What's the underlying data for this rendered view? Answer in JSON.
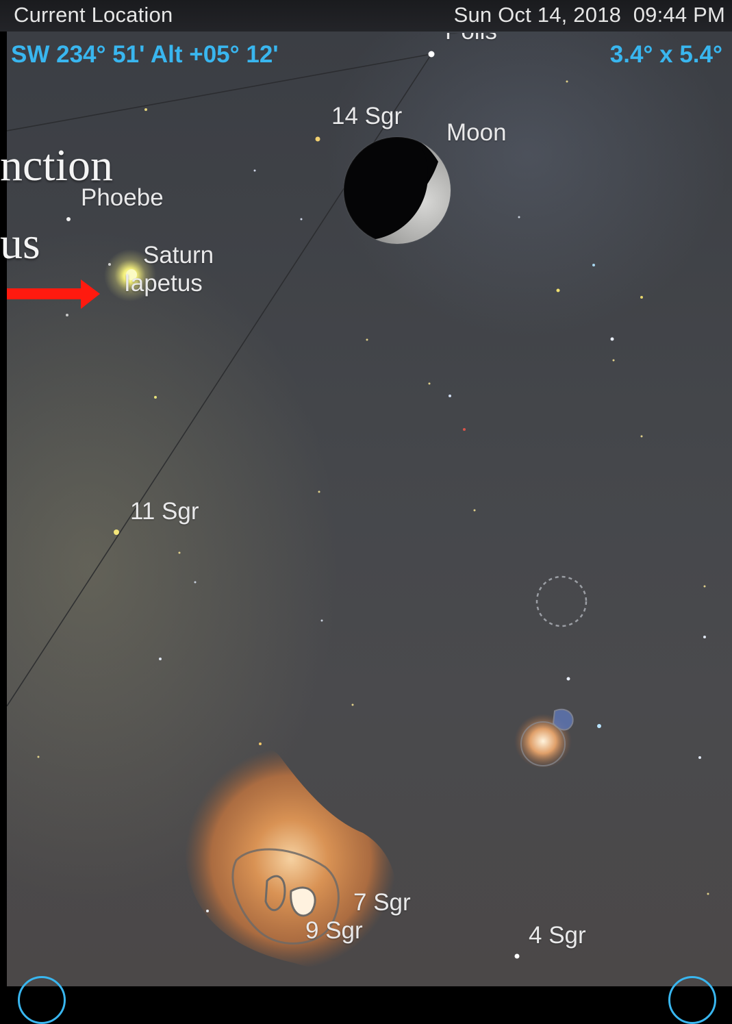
{
  "topbar": {
    "location": "Current Location",
    "datetime": "Sun Oct 14, 2018  09:44 PM"
  },
  "hud": {
    "pointing": "SW 234° 51' Alt +05° 12'",
    "field_of_view": "3.4° x 5.4°"
  },
  "slide_overlay": {
    "line1": "nction",
    "line2": "us"
  },
  "labels": {
    "polis": "Polis",
    "sgr14": "14 Sgr",
    "moon": "Moon",
    "phoebe": "Phoebe",
    "saturn": "Saturn",
    "iapetus": "Iapetus",
    "sgr11": "11 Sgr",
    "sgr7": "7 Sgr",
    "sgr9": "9 Sgr",
    "sgr4": "4 Sgr"
  },
  "colors": {
    "hud_accent": "#39b6ef",
    "arrow": "#ff1a0f",
    "saturn": "#f4f07a",
    "nebula": "#e08a4a"
  },
  "icons": {
    "arrow": "right-arrow-icon",
    "target": "dashed-target-circle-icon"
  }
}
